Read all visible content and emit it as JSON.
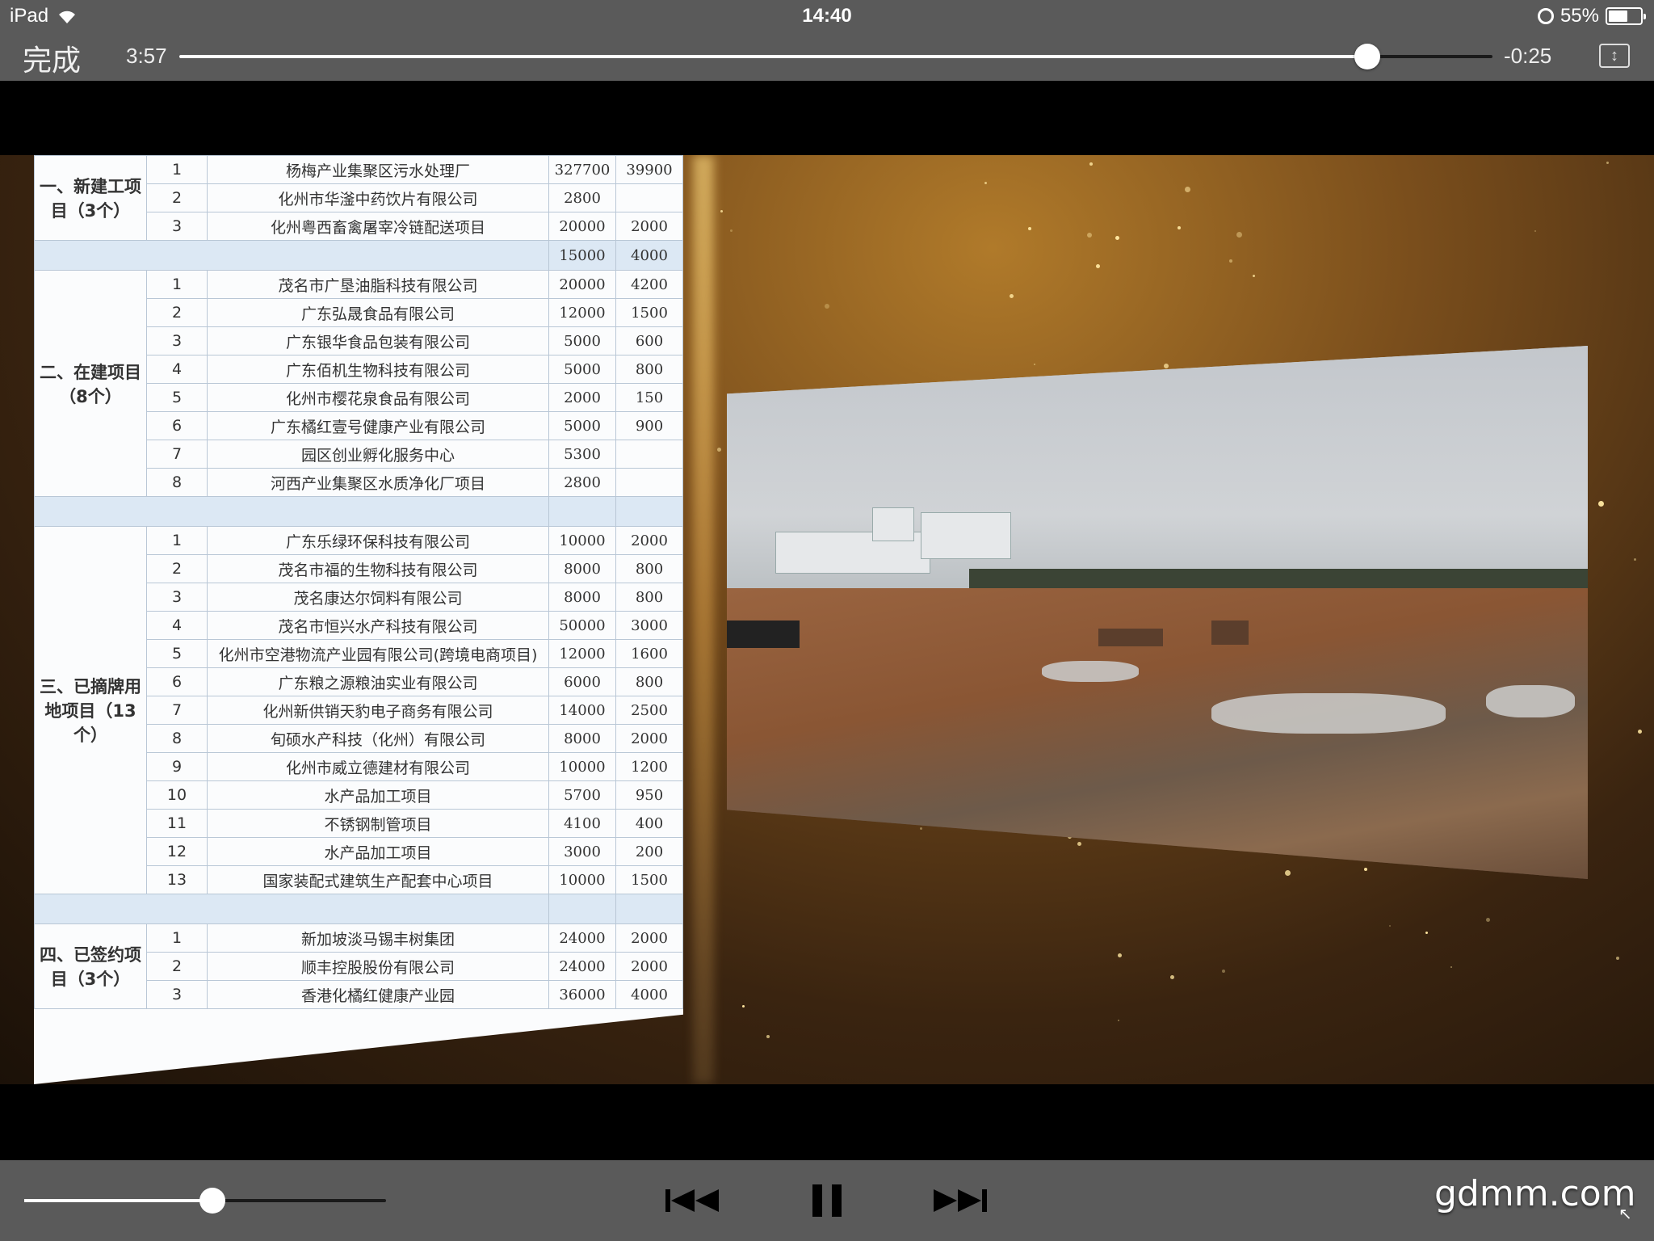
{
  "status_bar": {
    "device": "iPad",
    "time": "14:40",
    "battery": "55%"
  },
  "player": {
    "done_label": "完成",
    "elapsed": "3:57",
    "remaining": "-0:25",
    "progress_fraction": 0.9047,
    "volume_fraction": 0.52
  },
  "table": {
    "groups": [
      {
        "label": "一、新建工项目（3个）",
        "rows": [
          {
            "no": "1",
            "name": "杨梅产业集聚区污水处理厂",
            "a": "327700",
            "b": "39900"
          },
          {
            "no": "2",
            "name": "化州市华滏中药饮片有限公司",
            "a": "2800",
            "b": ""
          },
          {
            "no": "3",
            "name": "化州粤西畜禽屠宰冷链配送项目",
            "a": "20000",
            "b": "2000"
          }
        ],
        "band": {
          "a": "15000",
          "b": "4000"
        }
      },
      {
        "label": "二、在建项目（8个）",
        "rows": [
          {
            "no": "1",
            "name": "茂名市广垦油脂科技有限公司",
            "a": "20000",
            "b": "4200"
          },
          {
            "no": "2",
            "name": "广东弘晟食品有限公司",
            "a": "12000",
            "b": "1500"
          },
          {
            "no": "3",
            "name": "广东银华食品包装有限公司",
            "a": "5000",
            "b": "600"
          },
          {
            "no": "4",
            "name": "广东佰机生物科技有限公司",
            "a": "5000",
            "b": "800"
          },
          {
            "no": "5",
            "name": "化州市樱花泉食品有限公司",
            "a": "2000",
            "b": "150"
          },
          {
            "no": "6",
            "name": "广东橘红壹号健康产业有限公司",
            "a": "5000",
            "b": "900"
          },
          {
            "no": "7",
            "name": "园区创业孵化服务中心",
            "a": "5300",
            "b": ""
          },
          {
            "no": "8",
            "name": "河西产业集聚区水质净化厂项目",
            "a": "2800",
            "b": ""
          }
        ]
      },
      {
        "label": "三、已摘牌用地项目（13个）",
        "rows": [
          {
            "no": "1",
            "name": "广东乐绿环保科技有限公司",
            "a": "10000",
            "b": "2000"
          },
          {
            "no": "2",
            "name": "茂名市福的生物科技有限公司",
            "a": "8000",
            "b": "800"
          },
          {
            "no": "3",
            "name": "茂名康达尔饲料有限公司",
            "a": "8000",
            "b": "800"
          },
          {
            "no": "4",
            "name": "茂名市恒兴水产科技有限公司",
            "a": "50000",
            "b": "3000"
          },
          {
            "no": "5",
            "name": "化州市空港物流产业园有限公司(跨境电商项目)",
            "a": "12000",
            "b": "1600"
          },
          {
            "no": "6",
            "name": "广东粮之源粮油实业有限公司",
            "a": "6000",
            "b": "800"
          },
          {
            "no": "7",
            "name": "化州新供销天豹电子商务有限公司",
            "a": "14000",
            "b": "2500"
          },
          {
            "no": "8",
            "name": "旬硕水产科技（化州）有限公司",
            "a": "8000",
            "b": "2000"
          },
          {
            "no": "9",
            "name": "化州市威立德建材有限公司",
            "a": "10000",
            "b": "1200"
          },
          {
            "no": "10",
            "name": "水产品加工项目",
            "a": "5700",
            "b": "950"
          },
          {
            "no": "11",
            "name": "不锈钢制管项目",
            "a": "4100",
            "b": "400"
          },
          {
            "no": "12",
            "name": "水产品加工项目",
            "a": "3000",
            "b": "200"
          },
          {
            "no": "13",
            "name": "国家装配式建筑生产配套中心项目",
            "a": "10000",
            "b": "1500"
          }
        ]
      },
      {
        "label": "四、已签约项目（3个）",
        "rows": [
          {
            "no": "1",
            "name": "新加坡淡马锡丰树集团",
            "a": "24000",
            "b": "2000"
          },
          {
            "no": "2",
            "name": "顺丰控股股份有限公司",
            "a": "24000",
            "b": "2000"
          },
          {
            "no": "3",
            "name": "香港化橘红健康产业园",
            "a": "36000",
            "b": "4000"
          }
        ]
      }
    ]
  },
  "watermark": "gdmm.com"
}
